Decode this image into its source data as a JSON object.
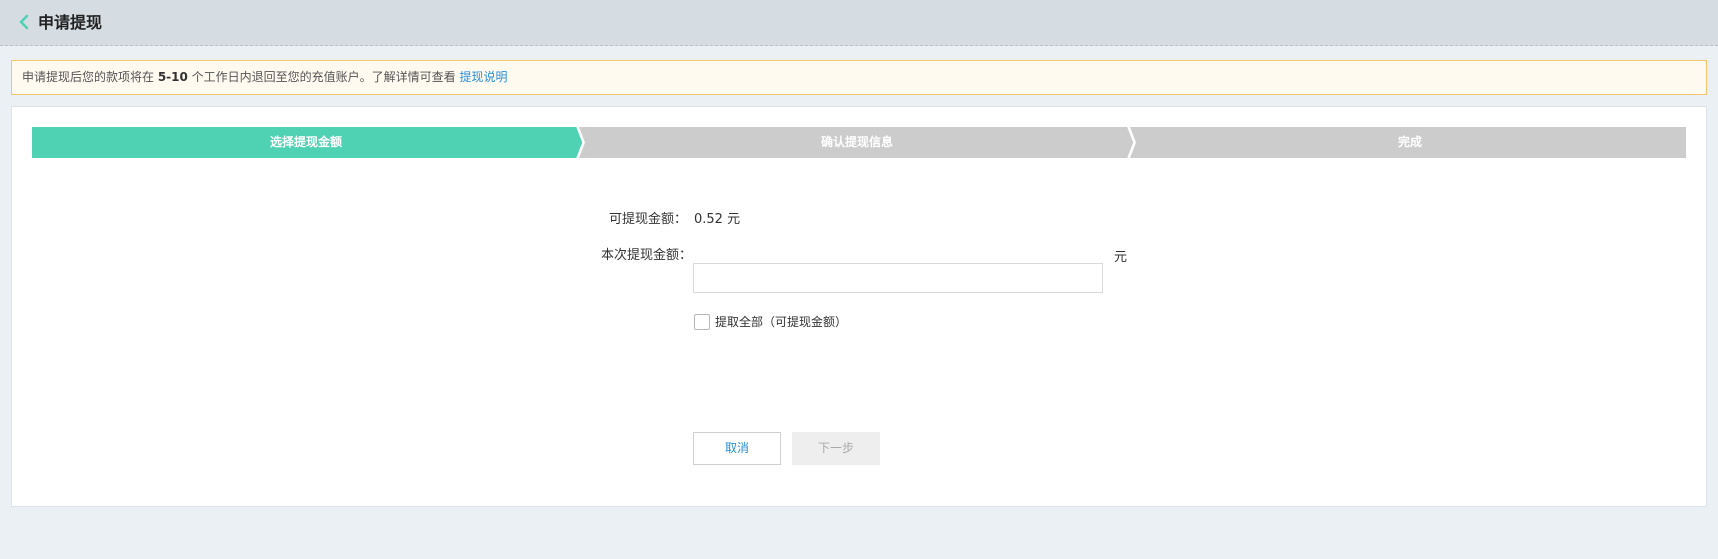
{
  "header": {
    "title": "申请提现",
    "back_icon": "chevron-left-icon",
    "accent_color": "#4fd1b3"
  },
  "notice": {
    "text_before": "申请提现后您的款项将在 ",
    "days": "5-10",
    "text_after": " 个工作日内退回至您的充值账户。了解详情可查看 ",
    "link_text": "提现说明"
  },
  "steps": {
    "items": [
      {
        "label": "选择提现金额",
        "state": "active"
      },
      {
        "label": "确认提现信息",
        "state": "pending"
      },
      {
        "label": "完成",
        "state": "pending"
      }
    ],
    "active_color": "#4fd1b3",
    "pending_color": "#cccccc"
  },
  "form": {
    "available_label": "可提现金额：",
    "available_value": "0.52 元",
    "amount_label": "本次提现金额：",
    "amount_value": "",
    "amount_placeholder": "",
    "amount_unit": "元",
    "withdraw_all_label": "提取全部（可提现金额）",
    "withdraw_all_checked": false
  },
  "actions": {
    "cancel_label": "取消",
    "next_label": "下一步"
  }
}
